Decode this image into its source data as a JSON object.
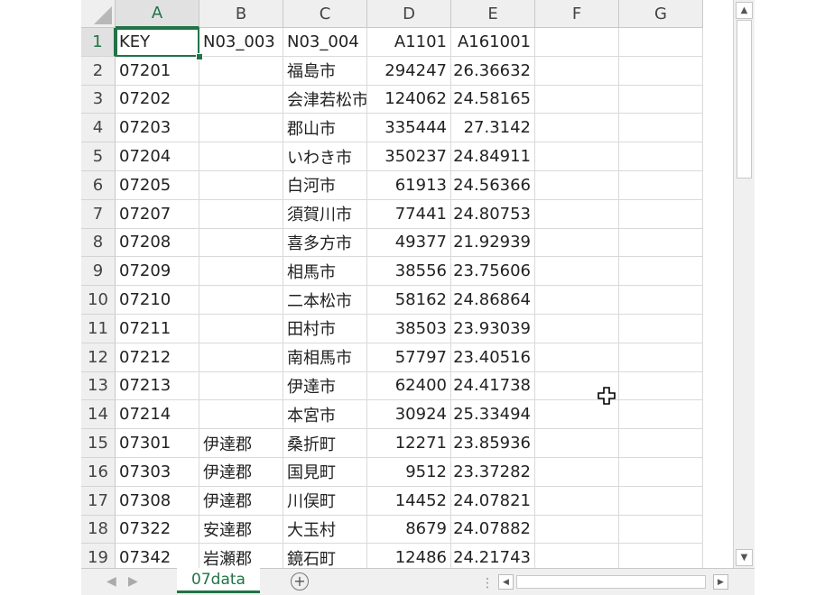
{
  "columns": [
    "A",
    "B",
    "C",
    "D",
    "E",
    "F",
    "G"
  ],
  "rows": [
    {
      "num": "1",
      "a": "KEY",
      "b": "N03_003",
      "c": "N03_004",
      "d": "A1101",
      "e": "A161001"
    },
    {
      "num": "2",
      "a": "07201",
      "b": "",
      "c": "福島市",
      "d": "294247",
      "e": "26.36632"
    },
    {
      "num": "3",
      "a": "07202",
      "b": "",
      "c": "会津若松市",
      "d": "124062",
      "e": "24.58165"
    },
    {
      "num": "4",
      "a": "07203",
      "b": "",
      "c": "郡山市",
      "d": "335444",
      "e": "27.3142"
    },
    {
      "num": "5",
      "a": "07204",
      "b": "",
      "c": "いわき市",
      "d": "350237",
      "e": "24.84911"
    },
    {
      "num": "6",
      "a": "07205",
      "b": "",
      "c": "白河市",
      "d": "61913",
      "e": "24.56366"
    },
    {
      "num": "7",
      "a": "07207",
      "b": "",
      "c": "須賀川市",
      "d": "77441",
      "e": "24.80753"
    },
    {
      "num": "8",
      "a": "07208",
      "b": "",
      "c": "喜多方市",
      "d": "49377",
      "e": "21.92939"
    },
    {
      "num": "9",
      "a": "07209",
      "b": "",
      "c": "相馬市",
      "d": "38556",
      "e": "23.75606"
    },
    {
      "num": "10",
      "a": "07210",
      "b": "",
      "c": "二本松市",
      "d": "58162",
      "e": "24.86864"
    },
    {
      "num": "11",
      "a": "07211",
      "b": "",
      "c": "田村市",
      "d": "38503",
      "e": "23.93039"
    },
    {
      "num": "12",
      "a": "07212",
      "b": "",
      "c": "南相馬市",
      "d": "57797",
      "e": "23.40516"
    },
    {
      "num": "13",
      "a": "07213",
      "b": "",
      "c": "伊達市",
      "d": "62400",
      "e": "24.41738"
    },
    {
      "num": "14",
      "a": "07214",
      "b": "",
      "c": "本宮市",
      "d": "30924",
      "e": "25.33494"
    },
    {
      "num": "15",
      "a": "07301",
      "b": "伊達郡",
      "c": "桑折町",
      "d": "12271",
      "e": "23.85936"
    },
    {
      "num": "16",
      "a": "07303",
      "b": "伊達郡",
      "c": "国見町",
      "d": "9512",
      "e": "23.37282"
    },
    {
      "num": "17",
      "a": "07308",
      "b": "伊達郡",
      "c": "川俣町",
      "d": "14452",
      "e": "24.07821"
    },
    {
      "num": "18",
      "a": "07322",
      "b": "安達郡",
      "c": "大玉村",
      "d": "8679",
      "e": "24.07882"
    },
    {
      "num": "19",
      "a": "07342",
      "b": "岩瀬郡",
      "c": "鏡石町",
      "d": "12486",
      "e": "24.21743"
    }
  ],
  "sheet_tab": "07data",
  "add_sheet_symbol": "+",
  "active_cell": "A1",
  "accent_color": "#217346",
  "icons": {
    "scroll_up": "▲",
    "scroll_down": "▼",
    "scroll_left": "◀",
    "scroll_right": "▶",
    "tab_prev": "◀",
    "tab_next": "▶",
    "tab_split": "⋮",
    "cursor": "fat-cross-cursor-icon"
  }
}
